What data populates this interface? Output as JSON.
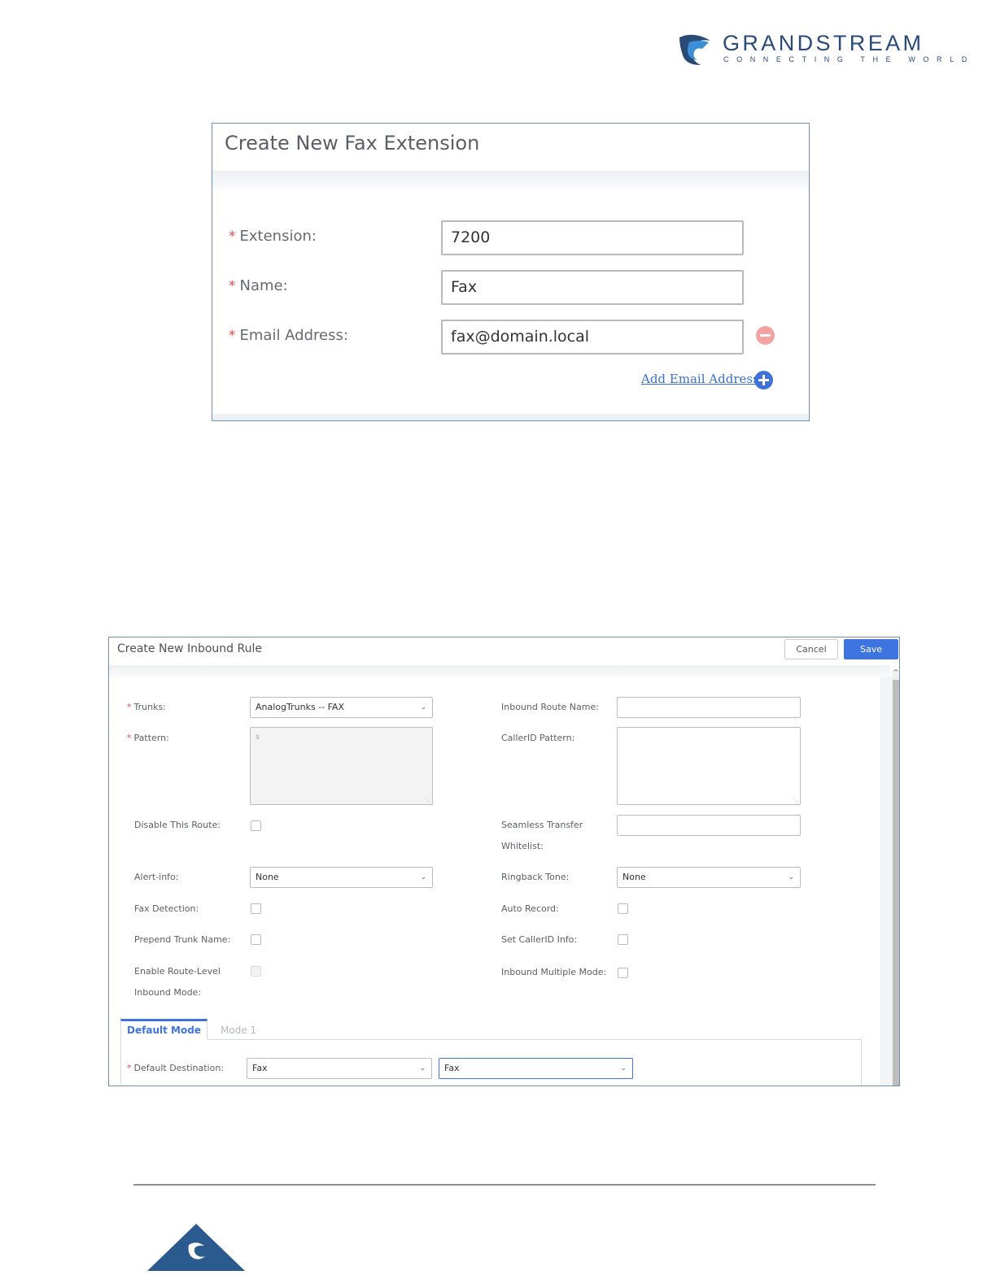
{
  "brand": {
    "name": "GRANDSTREAM",
    "tagline": "CONNECTING THE WORLD",
    "color": "#2a4a78"
  },
  "fax_extension": {
    "title": "Create New Fax Extension",
    "fields": {
      "extension": {
        "label": "Extension:",
        "value": "7200"
      },
      "name": {
        "label": "Name:",
        "value": "Fax"
      },
      "email": {
        "label": "Email Address:",
        "value": "fax@domain.local"
      }
    },
    "add_email_link": "Add Email Address",
    "required_marker": "*"
  },
  "inbound_rule": {
    "title": "Create New Inbound Rule",
    "buttons": {
      "cancel": "Cancel",
      "save": "Save"
    },
    "left": {
      "trunks": {
        "label": "Trunks:",
        "value": "AnalogTrunks -- FAX"
      },
      "pattern": {
        "label": "Pattern:",
        "value": "s"
      },
      "disable_route": {
        "label": "Disable This Route:"
      },
      "alert_info": {
        "label": "Alert-info:",
        "value": "None"
      },
      "fax_detection": {
        "label": "Fax Detection:"
      },
      "prepend_trunk_name": {
        "label": "Prepend Trunk Name:"
      },
      "route_level_mode": {
        "label_line1": "Enable Route-Level",
        "label_line2": "Inbound Mode:"
      }
    },
    "right": {
      "route_name": {
        "label": "Inbound Route Name:",
        "value": ""
      },
      "callerid_pattern": {
        "label": "CallerID Pattern:",
        "value": ""
      },
      "seamless_transfer": {
        "label_line1": "Seamless Transfer",
        "label_line2": "Whitelist:",
        "value": ""
      },
      "ringback_tone": {
        "label": "Ringback Tone:",
        "value": "None"
      },
      "auto_record": {
        "label": "Auto Record:"
      },
      "set_callerid_info": {
        "label": "Set CallerID Info:"
      },
      "inbound_multiple_mode": {
        "label": "Inbound Multiple Mode:"
      }
    },
    "tabs": [
      {
        "label": "Default Mode",
        "active": true
      },
      {
        "label": "Mode 1",
        "active": false
      }
    ],
    "default_destination": {
      "label": "Default Destination:",
      "type_value": "Fax",
      "target_value": "Fax"
    },
    "required_marker": "*",
    "accent_color": "#3d74e0"
  }
}
